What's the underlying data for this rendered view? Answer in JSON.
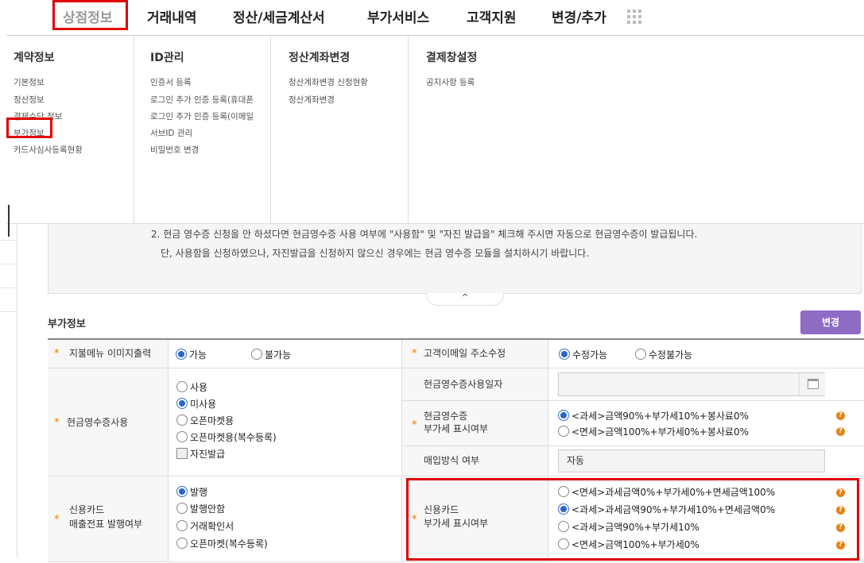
{
  "nav": {
    "items": [
      "상점정보",
      "거래내역",
      "정산/세금계산서",
      "부가서비스",
      "고객지원",
      "변경/추가"
    ]
  },
  "menu": {
    "columns": [
      {
        "title": "계약정보",
        "links": [
          "기본정보",
          "정산정보",
          "결제수단 정보",
          "부가정보",
          "카드사심사등록현황"
        ]
      },
      {
        "title": "ID관리",
        "links": [
          "인증서 등록",
          "로그인 추가 인증 등록(휴대폰",
          "로그인 추가 인증 등록(이메일",
          "서브ID 관리",
          "비밀번호 변경"
        ]
      },
      {
        "title": "정산계좌변경",
        "links": [
          "정산계좌변경 신청현황",
          "정산계좌변경"
        ]
      },
      {
        "title": "결제창설정",
        "links": [
          "공지사항 등록"
        ]
      }
    ]
  },
  "notice": {
    "line1": "2. 현금 영수증 신청을 안 하셨다면 현금영수증 사용 여부에 \"사용함\" 및 \"자진 발급을\" 체크해 주시면 자동으로 현금영수증이 발급됩니다.",
    "line2": "단, 사용함을 신청하였으나, 자진발급을 신청하지 않으신 경우에는 현금 영수증 모듈을 설치하시기 바랍니다.",
    "toggle": "^"
  },
  "section": {
    "title": "부가정보",
    "change_label": "변경"
  },
  "form": {
    "payment_menu_image": {
      "label": "지불메뉴 이미지출력",
      "options": [
        "가능",
        "불가능"
      ],
      "selected": 0
    },
    "customer_email_edit": {
      "label": "고객이메일 주소수정",
      "options": [
        "수정가능",
        "수정불가능"
      ],
      "selected": 0
    },
    "cash_receipt_use": {
      "label": "현금영수증사용",
      "options": [
        "사용",
        "미사용",
        "오픈마켓용",
        "오픈마켓용(복수등록)"
      ],
      "selected": 1,
      "checkbox": "자진발급"
    },
    "cash_receipt_date": {
      "label": "현금영수증사용일자",
      "value": ""
    },
    "cash_receipt_vat": {
      "label1": "현금영수증",
      "label2": "부가세 표시여부",
      "options": [
        "<과세>금액90%+부가세10%+봉사료0%",
        "<면세>금액100%+부가세0%+봉사료0%"
      ],
      "selected": 0
    },
    "purchase_method": {
      "label": "매입방식 여부",
      "value": "자동"
    },
    "card_slip_issue": {
      "label1": "신용카드",
      "label2": "매출전표 발행여부",
      "options": [
        "발행",
        "발행안함",
        "거래확인서",
        "오픈마켓(복수등록)"
      ],
      "selected": 0
    },
    "card_vat": {
      "label1": "신용카드",
      "label2": "부가세 표시여부",
      "options": [
        "<면세>과세금액0%+부가세0%+면세금액100%",
        "<과세>과세금액90%+부가세10%+면세금액0%",
        "<과세>금액90%+부가세10%",
        "<면세>금액100%+부가세0%"
      ],
      "selected": 1
    }
  },
  "colors": {
    "highlight": "#e00000",
    "accent_button": "#8e6cc4",
    "radio_selected": "#2d65cc",
    "required_star": "#e87b00"
  }
}
